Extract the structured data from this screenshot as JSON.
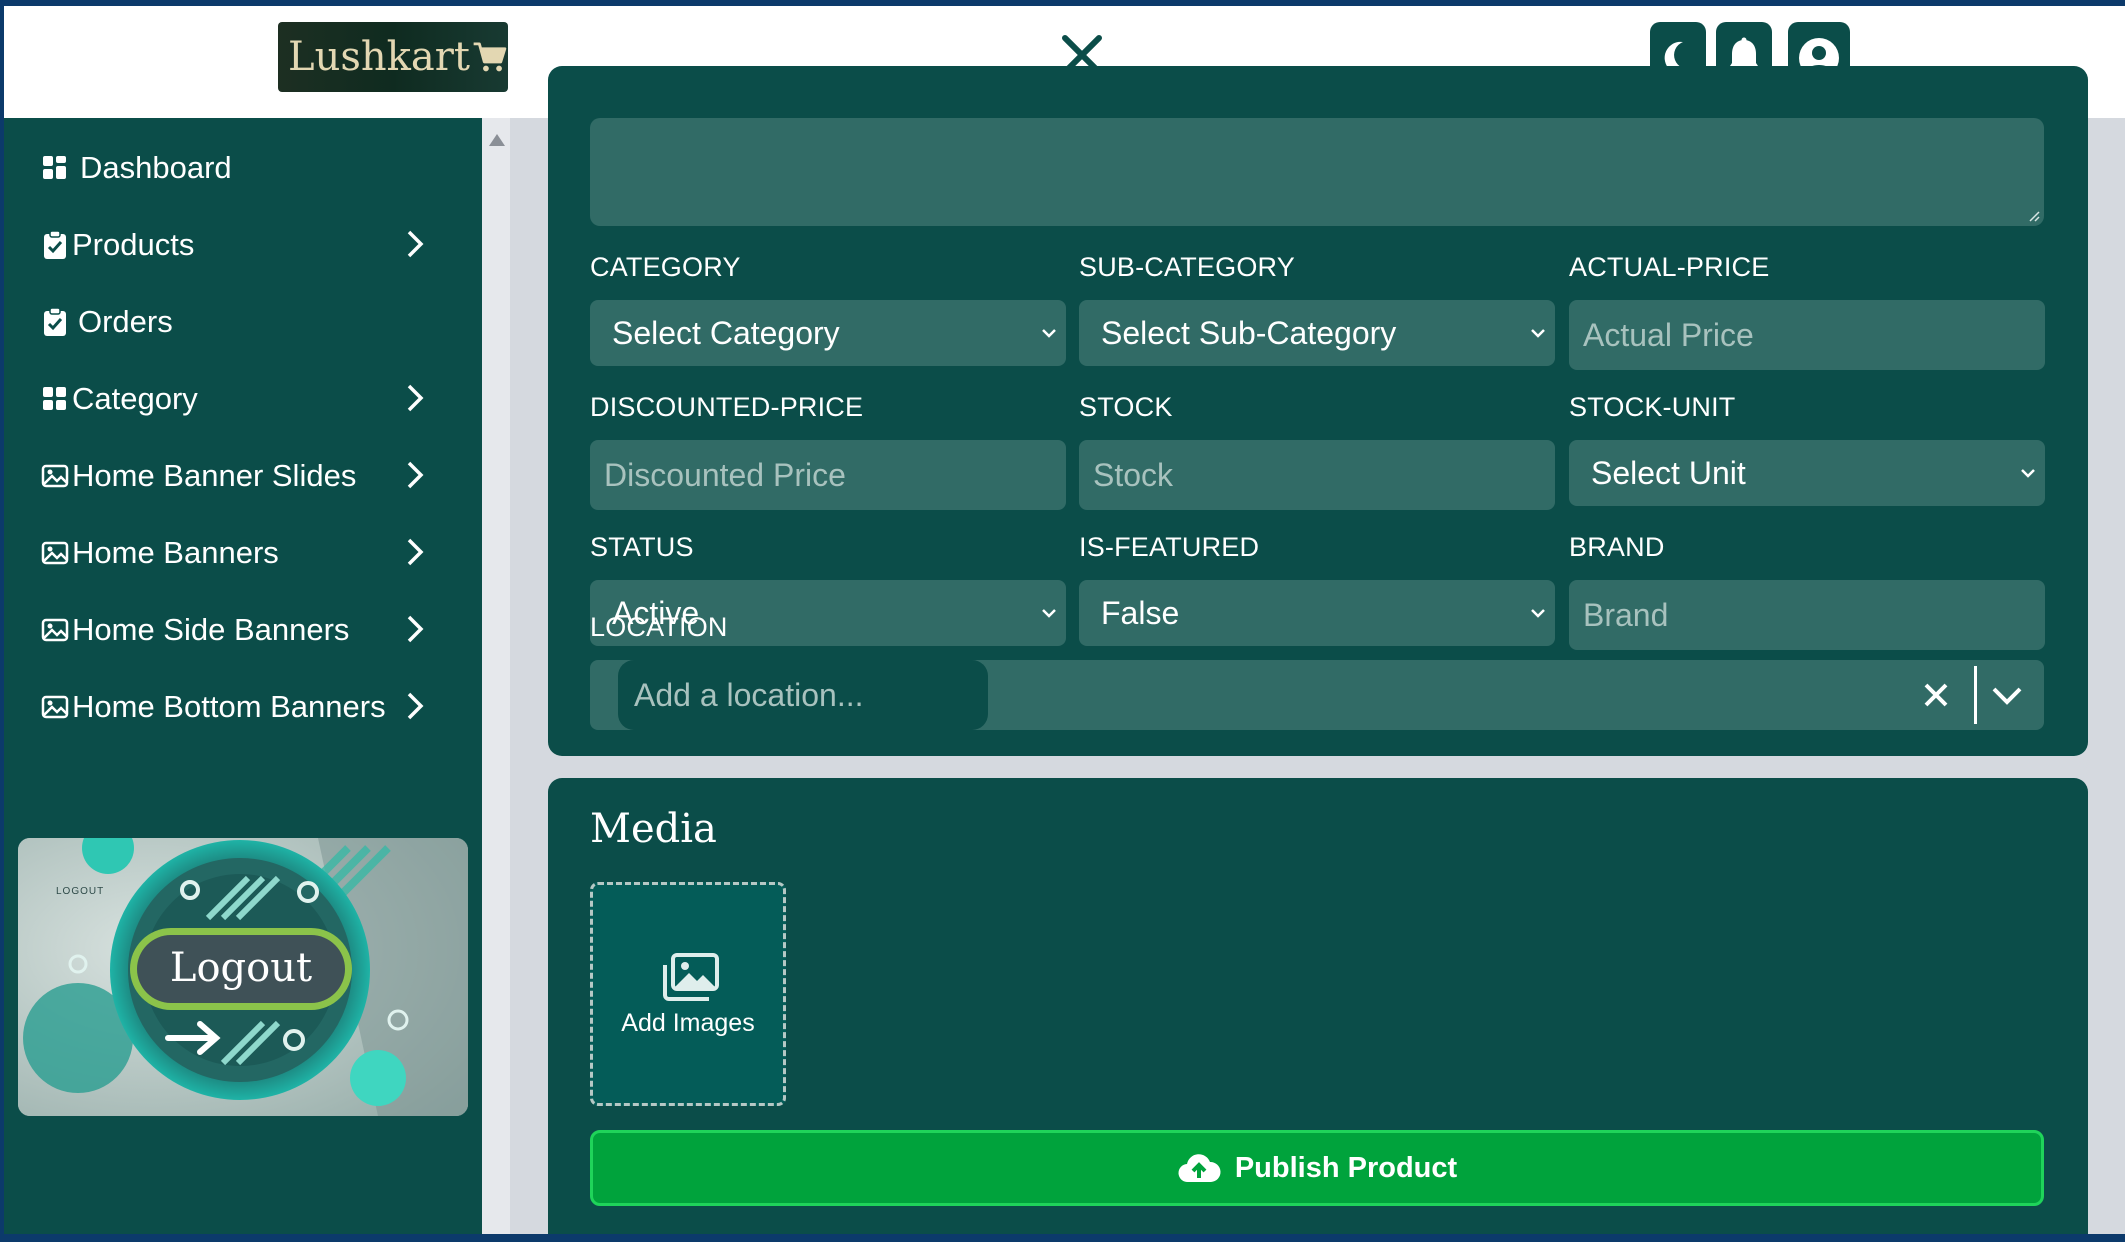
{
  "header": {
    "logo_text": "Lushkart",
    "icons": [
      "cart-icon",
      "close-icon",
      "moon-icon",
      "bell-icon",
      "user-circle-icon"
    ]
  },
  "sidebar": {
    "items": [
      {
        "label": "Dashboard",
        "icon": "grid-icon",
        "has_submenu": false
      },
      {
        "label": "Products",
        "icon": "clipboard-check-icon",
        "has_submenu": true
      },
      {
        "label": "Orders",
        "icon": "clipboard-check-icon",
        "has_submenu": false
      },
      {
        "label": "Category",
        "icon": "grid-icon",
        "has_submenu": true
      },
      {
        "label": "Home Banner Slides",
        "icon": "image-icon",
        "has_submenu": true
      },
      {
        "label": "Home Banners",
        "icon": "image-icon",
        "has_submenu": true
      },
      {
        "label": "Home Side Banners",
        "icon": "image-icon",
        "has_submenu": true
      },
      {
        "label": "Home Bottom Banners",
        "icon": "image-icon",
        "has_submenu": true
      }
    ],
    "logout": {
      "label": "Logout",
      "small_label": "LOGOUT"
    }
  },
  "form": {
    "category": {
      "label": "CATEGORY",
      "value": "Select Category"
    },
    "sub_category": {
      "label": "SUB-CATEGORY",
      "value": "Select Sub-Category"
    },
    "actual_price": {
      "label": "ACTUAL-PRICE",
      "placeholder": "Actual Price"
    },
    "discounted_price": {
      "label": "DISCOUNTED-PRICE",
      "placeholder": "Discounted Price"
    },
    "stock": {
      "label": "STOCK",
      "placeholder": "Stock"
    },
    "stock_unit": {
      "label": "STOCK-UNIT",
      "value": "Select Unit"
    },
    "status": {
      "label": "STATUS",
      "value": "Active"
    },
    "is_featured": {
      "label": "IS-FEATURED",
      "value": "False"
    },
    "brand": {
      "label": "BRAND",
      "placeholder": "Brand"
    },
    "location": {
      "label": "LOCATION",
      "placeholder": "Add a location..."
    }
  },
  "media": {
    "title": "Media",
    "add_images_label": "Add Images",
    "publish_label": "Publish Product"
  },
  "colors": {
    "primary": "#0b4d49",
    "field_bg": "#316b66",
    "publish_green": "#00a33c",
    "page_bg": "#d5d9df"
  }
}
